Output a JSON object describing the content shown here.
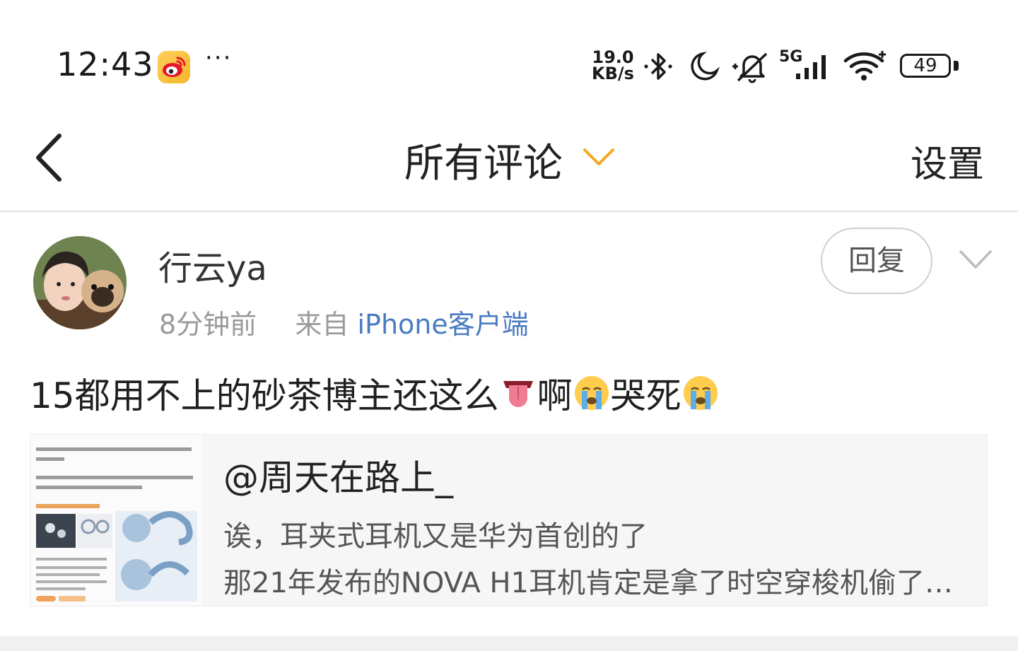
{
  "status_bar": {
    "time": "12:43",
    "more": "···",
    "net_speed_value": "19.0",
    "net_speed_unit": "KB/s",
    "network": "5G",
    "battery": "49",
    "icons": [
      "weibo-app-icon",
      "bluetooth-icon",
      "do-not-disturb-moon-icon",
      "mute-bell-icon",
      "signal-icon",
      "wifi-icon",
      "battery-icon"
    ]
  },
  "nav": {
    "title": "所有评论",
    "settings_label": "设置"
  },
  "comment": {
    "username": "行云ya",
    "time_ago": "8分钟前",
    "from_prefix": "来自",
    "source": "iPhone客户端",
    "reply_label": "回复",
    "text_part1": "15都用不上的砂茶博主还这么",
    "text_part2": "啊",
    "text_part3": "哭死",
    "emojis": [
      "tongue-emoji",
      "crying-emoji",
      "crying-emoji"
    ]
  },
  "quoted_post": {
    "author": "@周天在路上_",
    "line1": "诶，耳夹式耳机又是华为首创的了",
    "line2": "那21年发布的NOVA H1耳机肯定是拿了时空穿梭机偷了…"
  },
  "colors": {
    "accent_orange": "#f5a623",
    "link_blue": "#4a7bc0",
    "meta_gray": "#9a9a9a",
    "card_bg": "#f6f6f6"
  }
}
